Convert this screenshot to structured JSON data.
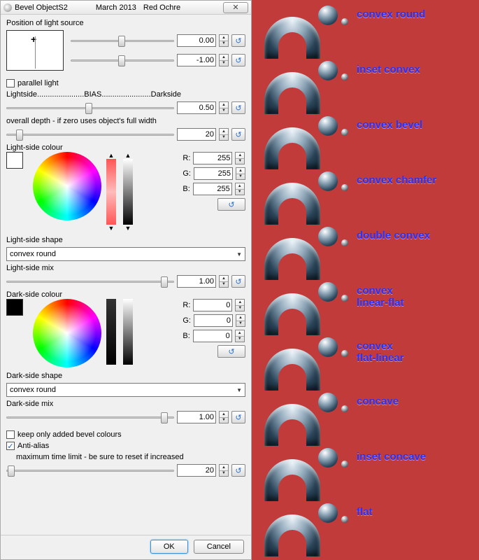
{
  "title": "Bevel ObjectS2",
  "title_date": "March 2013",
  "title_author": "Red Ochre",
  "labels": {
    "pos_light": "Position of light source",
    "parallel": "parallel light",
    "bias": "Lightside......................BIAS.......................Darkside",
    "depth": "overall depth - if zero uses object's full width",
    "lsc": "Light-side colour",
    "lss": "Light-side shape",
    "lsm": "Light-side mix",
    "dsc": "Dark-side colour",
    "dss": "Dark-side shape",
    "dsm": "Dark-side mix",
    "keep": "keep only added bevel colours",
    "aa": "Anti-alias",
    "timelimit": "maximum time limit - be sure to reset if increased",
    "r": "R:",
    "g": "G:",
    "b": "B:"
  },
  "values": {
    "px": "0.00",
    "py": "-1.00",
    "bias": "0.50",
    "depth": "20",
    "lr": "255",
    "lg": "255",
    "lb": "255",
    "dr": "0",
    "dg": "0",
    "db": "0",
    "lmix": "1.00",
    "dmix": "1.00",
    "tlimit": "20",
    "lshape": "convex round",
    "dshape": "convex round",
    "parallel_checked": "",
    "keep_checked": "",
    "aa_checked": "✓"
  },
  "buttons": {
    "ok": "OK",
    "cancel": "Cancel"
  },
  "colors": {
    "light": "#ffffff",
    "dark": "#000000"
  },
  "preview_labels": [
    "convex round",
    "inset convex",
    "convex bevel",
    "convex chamfer",
    "double convex",
    "convex\nlinear-flat",
    "convex\nflat-linear",
    "concave",
    "inset concave",
    "flat"
  ]
}
